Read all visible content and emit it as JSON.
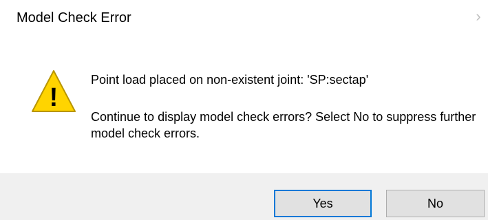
{
  "window": {
    "title": "Model Check Error",
    "close_glyph": "›"
  },
  "message": {
    "icon": "warning-icon",
    "icon_glyph": "!",
    "primary": "Point load placed on non-existent joint: 'SP:sectap'",
    "secondary": "Continue to display model check errors? Select No to suppress further model check errors."
  },
  "buttons": {
    "yes_label": "Yes",
    "no_label": "No"
  },
  "colors": {
    "warning_fill": "#ffd400",
    "warning_stroke": "#b89500",
    "focus_border": "#0078d7",
    "footer_bg": "#f0f0f0"
  }
}
